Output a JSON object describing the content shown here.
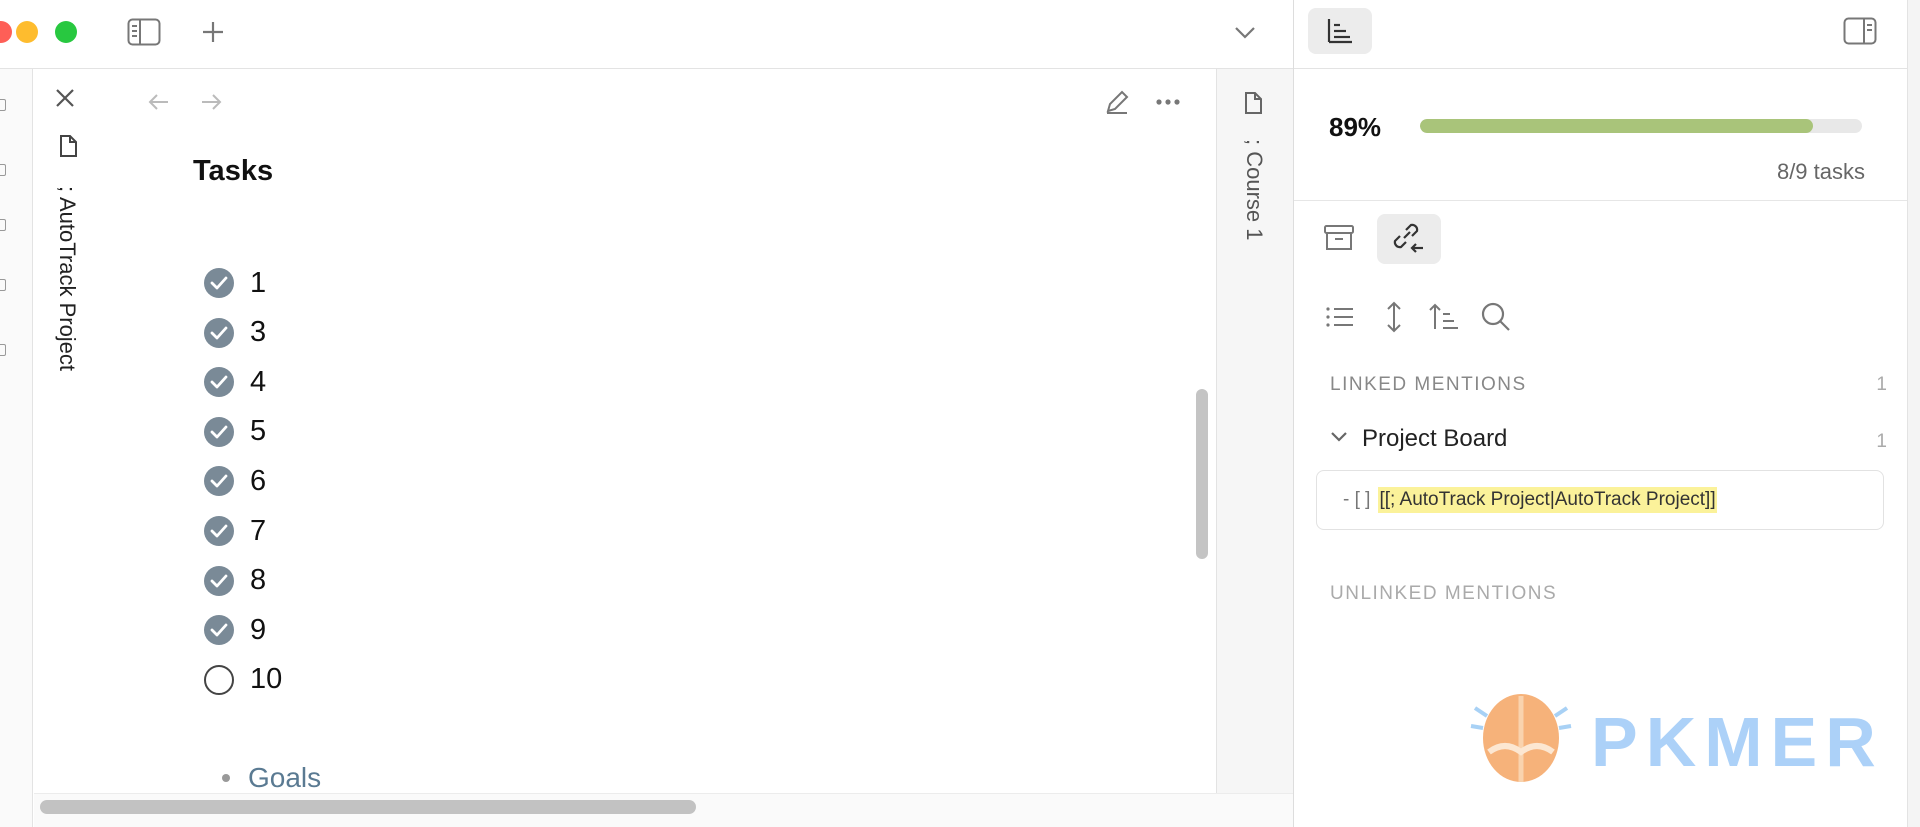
{
  "window": {
    "left_tab": {
      "title": "; AutoTrack Project"
    },
    "right_tab": {
      "title": "; Course 1"
    }
  },
  "note": {
    "heading": "Tasks",
    "tasks": [
      {
        "label": "1",
        "done": true
      },
      {
        "label": "3",
        "done": true
      },
      {
        "label": "4",
        "done": true
      },
      {
        "label": "5",
        "done": true
      },
      {
        "label": "6",
        "done": true
      },
      {
        "label": "7",
        "done": true
      },
      {
        "label": "8",
        "done": true
      },
      {
        "label": "9",
        "done": true
      },
      {
        "label": "10",
        "done": false
      }
    ],
    "bullet": "Goals"
  },
  "progress": {
    "percent_label": "89%",
    "fraction": 0.89,
    "count_label": "8/9 tasks"
  },
  "backlinks": {
    "linked_title": "LINKED MENTIONS",
    "linked_count": "1",
    "group_label": "Project Board",
    "group_count": "1",
    "mention_prefix": "- [ ]",
    "mention_link": "[[; AutoTrack Project|AutoTrack Project]]",
    "unlinked_title": "UNLINKED MENTIONS"
  },
  "watermark": {
    "text": "PKMER"
  },
  "colors": {
    "progress_fill": "#a9c47a",
    "task_done": "#7a8a97",
    "highlight": "#fbf29a",
    "link_text": "#5a7a92"
  },
  "icons": {
    "topbar": [
      "sidebar-toggle-icon",
      "plus-icon",
      "chevron-down-icon"
    ],
    "editor": [
      "close-icon",
      "file-icon",
      "arrow-left-icon",
      "arrow-right-icon",
      "edit-icon",
      "more-icon"
    ],
    "sidebar": [
      "progress-view-icon",
      "right-sidebar-toggle-icon",
      "archive-icon",
      "backlink-icon",
      "list-icon",
      "expand-icon",
      "sort-icon",
      "search-icon"
    ]
  }
}
